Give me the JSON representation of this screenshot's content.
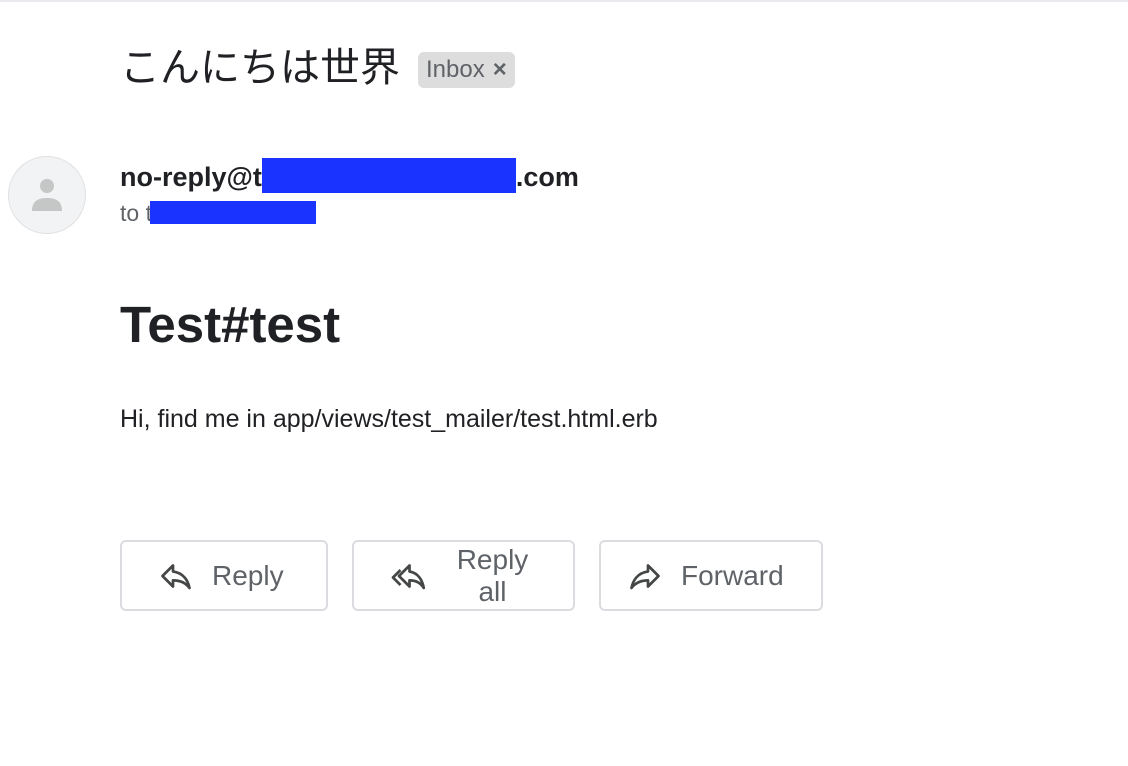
{
  "email": {
    "subject": "こんにちは世界",
    "label": "Inbox",
    "label_remove": "×",
    "sender": {
      "prefix": "no-reply@t",
      "suffix": ".com"
    },
    "recipient": {
      "prefix": "to t"
    },
    "body": {
      "heading": "Test#test",
      "text": "Hi, find me in app/views/test_mailer/test.html.erb"
    }
  },
  "actions": {
    "reply_label": "Reply",
    "reply_all_label": "Reply all",
    "forward_label": "Forward"
  },
  "icons": {
    "avatar": "person-icon",
    "reply": "reply-icon",
    "reply_all": "reply-all-icon",
    "forward": "forward-icon"
  },
  "colors": {
    "redaction": "#1a33ff",
    "chip_background": "#dddddd",
    "secondary_text": "#5f6368"
  }
}
